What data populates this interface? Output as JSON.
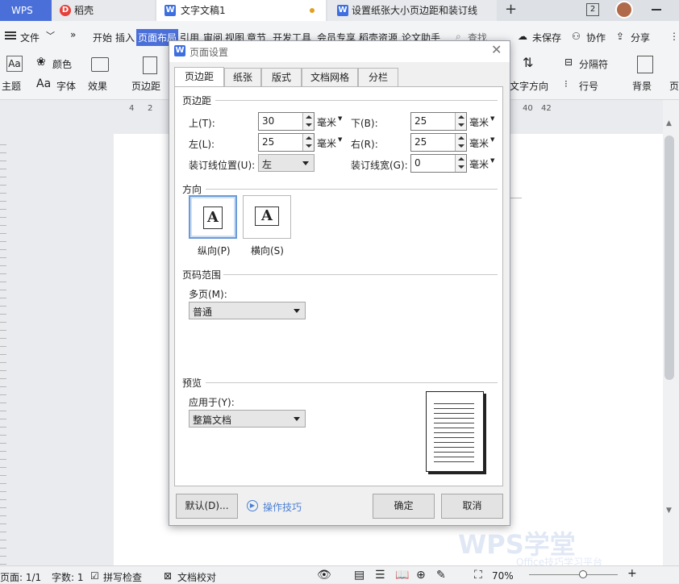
{
  "tabbar": {
    "app": "WPS",
    "tabs": [
      {
        "label": "稻壳"
      },
      {
        "label": "文字文稿1"
      },
      {
        "label": "设置纸张大小页边距和装订线"
      }
    ],
    "add": "+",
    "badge": "2"
  },
  "menu": {
    "file": "文件",
    "items": [
      "开始",
      "插入",
      "页面布局",
      "引用",
      "审阅",
      "视图",
      "章节",
      "开发工具",
      "会员专享",
      "稻壳资源",
      "论文助手"
    ],
    "search": "查找",
    "unsaved": "未保存",
    "collab": "协作",
    "share": "分享"
  },
  "ribbon": {
    "theme": "主题",
    "color": "颜色",
    "font": "字体",
    "effect": "效果",
    "margin": "页边距",
    "text_dir": "文字方向",
    "separator": "分隔符",
    "line_num": "行号",
    "background": "背景",
    "page": "页"
  },
  "ruler": {
    "left": [
      "4",
      "2"
    ],
    "right": [
      "40",
      "42"
    ]
  },
  "status": {
    "page": "页面: 1/1",
    "words": "字数: 1",
    "spell": "拼写检查",
    "proof": "文档校对",
    "zoom": "70%"
  },
  "dialog": {
    "title": "页面设置",
    "tabs": [
      "页边距",
      "纸张",
      "版式",
      "文档网格",
      "分栏"
    ],
    "margins_section": "页边距",
    "top_label": "上(T):",
    "top_value": "30",
    "bottom_label": "下(B):",
    "bottom_value": "25",
    "left_label": "左(L):",
    "left_value": "25",
    "right_label": "右(R):",
    "right_value": "25",
    "gutter_pos_label": "装订线位置(U):",
    "gutter_pos_value": "左",
    "gutter_label": "装订线宽(G):",
    "gutter_value": "0",
    "unit": "毫米",
    "orientation_section": "方向",
    "portrait": "纵向(P)",
    "landscape": "横向(S)",
    "orient_glyph": "A",
    "pages_section": "页码范围",
    "multi_label": "多页(M):",
    "multi_value": "普通",
    "preview_section": "预览",
    "apply_label": "应用于(Y):",
    "apply_value": "整篇文档",
    "default_btn": "默认(D)...",
    "tips": "操作技巧",
    "ok": "确定",
    "cancel": "取消"
  },
  "watermark": {
    "brand": "WPS学堂",
    "sub": "Office技巧学习平台"
  },
  "colors": {
    "accent": "#4a6fd8",
    "wps_red": "#e5403a"
  }
}
